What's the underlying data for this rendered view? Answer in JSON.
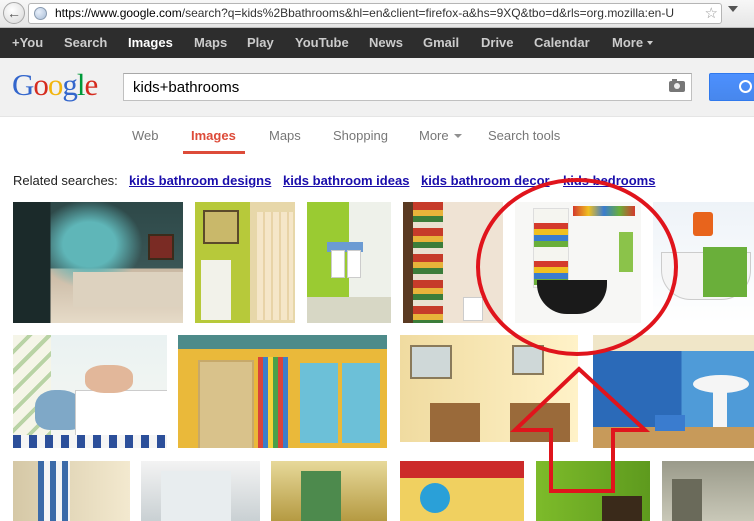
{
  "browser": {
    "url_host": "https://www.google.com",
    "url_path": "/search?q=kids%2Bbathrooms&hl=en&client=firefox-a&hs=9XQ&tbo=d&rls=org.mozilla:en-U"
  },
  "gbar": {
    "items": [
      "+You",
      "Search",
      "Images",
      "Maps",
      "Play",
      "YouTube",
      "News",
      "Gmail",
      "Drive",
      "Calendar",
      "More"
    ]
  },
  "logo": [
    "G",
    "o",
    "o",
    "g",
    "l",
    "e"
  ],
  "search": {
    "query": "kids+bathrooms"
  },
  "tabs": [
    "Web",
    "Images",
    "Maps",
    "Shopping",
    "More",
    "Search tools"
  ],
  "related": {
    "label": "Related searches:",
    "links": [
      "kids bathroom designs",
      "kids bathroom ideas",
      "kids bathroom decor",
      "kids bedrooms"
    ]
  },
  "colors": {
    "accent": "#dd4b39",
    "link": "#1a0dab",
    "gbar_bg": "#2d2d2d",
    "annotation": "#e0141c"
  }
}
